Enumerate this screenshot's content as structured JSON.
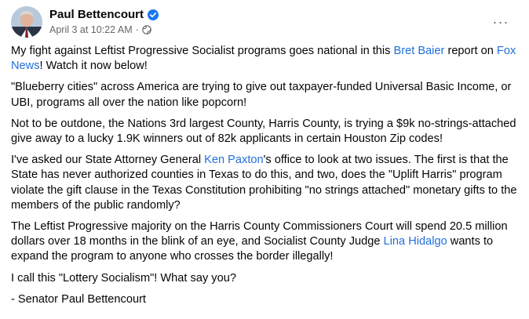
{
  "post": {
    "author": "Paul Bettencourt",
    "date": "April 3 at 10:22 AM",
    "separator": "·",
    "more_menu": "···",
    "paragraph1": {
      "before": "My fight against Leftist Progressive Socialist programs goes national in this ",
      "link1": "Bret Baier",
      "middle": " report on ",
      "link2": "Fox News",
      "after": "! Watch it now below!"
    },
    "paragraph2": "\"Blueberry cities\" across America are trying to give out taxpayer-funded Universal Basic Income, or UBI, programs all over the nation like popcorn!",
    "paragraph3": "Not to be outdone, the Nations 3rd largest County, Harris County, is trying a $9k no-strings-attached give away to a lucky 1.9K winners out of 82k applicants in certain Houston Zip codes!",
    "paragraph4": {
      "before": "I've asked our State Attorney General ",
      "link": "Ken Paxton",
      "after": "'s office to look at two issues. The first is that the State has never authorized counties in Texas to do this, and two, does the \"Uplift Harris\" program violate the gift clause in the Texas Constitution prohibiting \"no strings attached\" monetary gifts to the members of the public randomly?"
    },
    "paragraph5": {
      "before": "The Leftist Progressive majority on the Harris County Commissioners Court will spend 20.5 million dollars over 18 months in the blink of an eye, and Socialist County Judge ",
      "link": "Lina Hidalgo",
      "after": " wants to expand the program to anyone who crosses the border illegally!"
    },
    "paragraph6": "I call this \"Lottery Socialism\"! What say you?",
    "signature": "- Senator Paul Bettencourt"
  },
  "colors": {
    "link": "#216fdb",
    "meta": "#65676b",
    "verified": "#1877f2"
  },
  "icons": {
    "avatar": "avatar",
    "verified": "verified-badge-icon",
    "privacy": "globe-icon",
    "more": "more-horizontal-icon"
  }
}
